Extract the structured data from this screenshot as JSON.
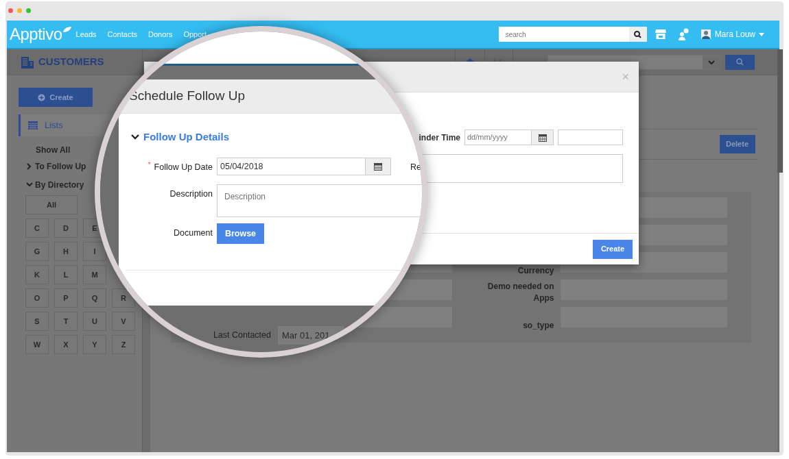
{
  "window": {
    "controls": [
      {
        "color": "#f25a5a"
      },
      {
        "color": "#f5b731"
      },
      {
        "color": "#3ac13a"
      }
    ]
  },
  "navbar": {
    "logo": "Apptivo",
    "links": [
      "Leads",
      "Contacts",
      "Donors",
      "Opport"
    ],
    "search": {
      "placeholder": "search"
    },
    "user": "Mara Louw"
  },
  "sidebar": {
    "title": "CUSTOMERS",
    "create": "Create",
    "lists": "Lists",
    "show_all": "Show All",
    "groups": [
      {
        "label": "To Follow Up",
        "expanded": false
      },
      {
        "label": "By Directory",
        "expanded": true
      }
    ],
    "letter_rows": [
      [
        "All"
      ],
      [
        "C",
        "D",
        "E"
      ],
      [
        "G",
        "H",
        "I"
      ],
      [
        "K",
        "L",
        "M"
      ],
      [
        "O",
        "P",
        "Q",
        "R"
      ],
      [
        "S",
        "T",
        "U",
        "V"
      ],
      [
        "W",
        "X",
        "Y",
        "Z"
      ]
    ]
  },
  "main": {
    "delete": "Delete",
    "form_rows": [
      {
        "kind": "blank"
      },
      {
        "kind": "blank"
      },
      {
        "kind": "field",
        "label": "Currency"
      },
      {
        "kind": "field",
        "label": "Demo needed on Apps"
      },
      {
        "kind": "field",
        "label": "so_type"
      }
    ]
  },
  "dialog": {
    "close": "×",
    "reminder_label": "inder Time",
    "reminder_date": {
      "placeholder": "dd/mm/yyyy"
    },
    "create": "Create"
  },
  "magnifier": {
    "title": "Schedule Follow Up",
    "section": {
      "title": "Follow Up Details",
      "expanded": true
    },
    "follow_up_date": {
      "marker": "*",
      "label": "Follow Up Date",
      "value": "05/04/2018"
    },
    "reminder_label": "Re",
    "description": {
      "label": "Description",
      "placeholder": "Description"
    },
    "document": {
      "label": "Document",
      "button": "Browse"
    },
    "last_contacted": {
      "label": "Last Contacted",
      "value": "Mar 01, 201"
    }
  }
}
